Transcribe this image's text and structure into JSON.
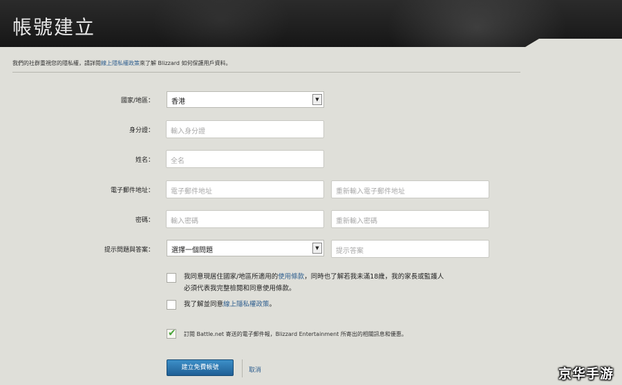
{
  "header": {
    "title": "帳號建立"
  },
  "notice": {
    "prefix": "我們的社群重視您的隱私權，請詳閱",
    "link": "線上隱私權政策",
    "suffix": "來了解 Blizzard 如何保護用戶資料。"
  },
  "form": {
    "country": {
      "label": "國家/地區：",
      "value": "香港"
    },
    "id_number": {
      "label": "身分證：",
      "placeholder": "輸入身分證"
    },
    "name": {
      "label": "姓名：",
      "placeholder": "全名"
    },
    "email": {
      "label": "電子郵件地址：",
      "placeholder": "電子郵件地址",
      "confirm_placeholder": "重新輸入電子郵件地址"
    },
    "password": {
      "label": "密碼：",
      "placeholder": "輸入密碼",
      "confirm_placeholder": "重新輸入密碼"
    },
    "security": {
      "label": "提示問題與答案：",
      "value": "選擇一個問題",
      "answer_placeholder": "提示答案"
    }
  },
  "agreements": {
    "tos": {
      "line1_prefix": "我同意現居住國家/地區所適用的",
      "line1_link": "使用條款",
      "line1_suffix": "，同時也了解若我未滿18歲，我的家長或監護人",
      "line2": "必須代表我完整檢閱和同意使用條款。"
    },
    "privacy": {
      "prefix": "我了解並同意",
      "link": "線上隱私權政策",
      "suffix": "。"
    },
    "newsletter": {
      "text": "訂閱 Battle.net 寄送的電子郵件報，Blizzard Entertainment 所寄出的相關訊息和優惠。"
    }
  },
  "buttons": {
    "create": "建立免費帳號",
    "cancel": "取消"
  },
  "watermark": "京华手游",
  "colors": {
    "accent_button": "#2a74b0",
    "link": "#2f5f8f",
    "check": "#4aa43a"
  }
}
